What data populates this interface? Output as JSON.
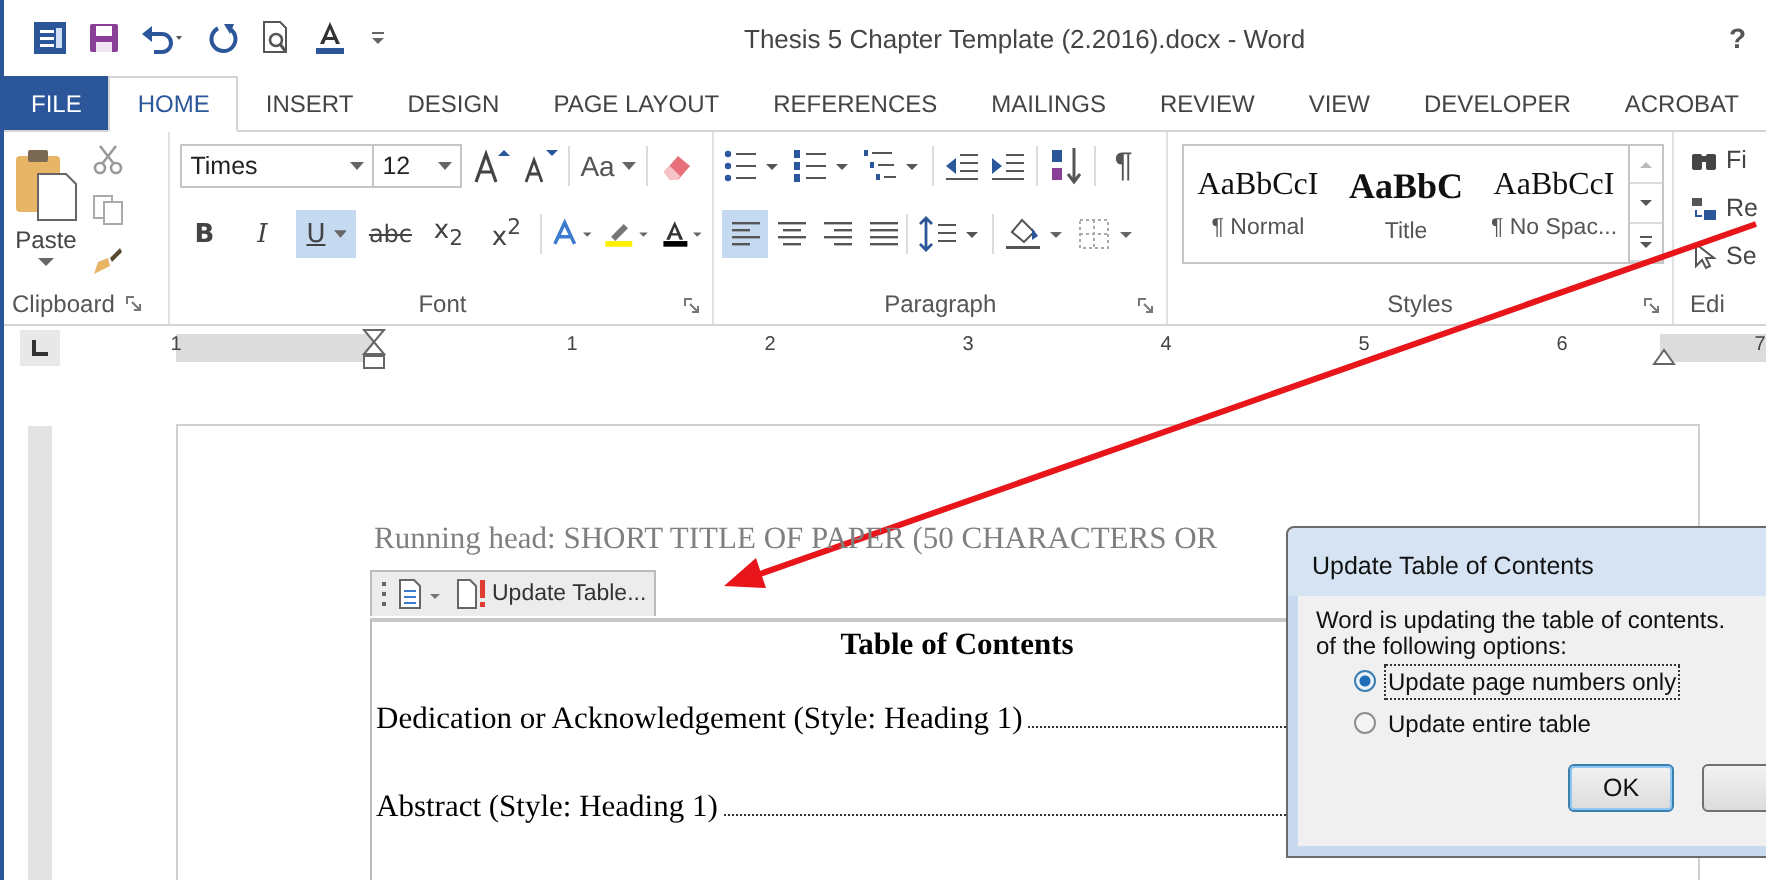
{
  "window": {
    "title": "Thesis 5 Chapter Template (2.2016).docx - Word",
    "help": "?"
  },
  "tabs": [
    {
      "label": "FILE",
      "kind": "file",
      "selected": false
    },
    {
      "label": "HOME",
      "kind": "tab",
      "selected": true
    },
    {
      "label": "INSERT",
      "kind": "tab",
      "selected": false
    },
    {
      "label": "DESIGN",
      "kind": "tab",
      "selected": false
    },
    {
      "label": "PAGE LAYOUT",
      "kind": "tab",
      "selected": false
    },
    {
      "label": "REFERENCES",
      "kind": "tab",
      "selected": false
    },
    {
      "label": "MAILINGS",
      "kind": "tab",
      "selected": false
    },
    {
      "label": "REVIEW",
      "kind": "tab",
      "selected": false
    },
    {
      "label": "VIEW",
      "kind": "tab",
      "selected": false
    },
    {
      "label": "DEVELOPER",
      "kind": "tab",
      "selected": false
    },
    {
      "label": "ACROBAT",
      "kind": "tab",
      "selected": false
    }
  ],
  "clipboard": {
    "paste": "Paste",
    "label": "Clipboard"
  },
  "font": {
    "face": "Times",
    "size": "12",
    "case": "Aa",
    "label": "Font",
    "format": [
      {
        "label": "B",
        "kind": "bold",
        "on": false
      },
      {
        "label": "I",
        "kind": "italic",
        "on": false
      },
      {
        "label": "U",
        "kind": "underline",
        "on": true
      },
      {
        "label": "abc",
        "kind": "strike",
        "on": false
      },
      {
        "label": "x$_{2}$",
        "kind": "plain",
        "on": false
      },
      {
        "label": "x$^{2}$",
        "kind": "plain",
        "on": false
      }
    ]
  },
  "paragraph": {
    "label": "Paragraph",
    "marks": "¶",
    "align": [
      {
        "kind": "left",
        "on": true
      },
      {
        "kind": "center",
        "on": false
      },
      {
        "kind": "right",
        "on": false
      },
      {
        "kind": "justify",
        "on": false
      }
    ]
  },
  "styles": {
    "label": "Styles",
    "items": [
      {
        "sample": "AaBbCcI",
        "name": "¶ Normal",
        "kind": "normal"
      },
      {
        "sample": "AaBbC",
        "name": "Title",
        "kind": "title"
      },
      {
        "sample": "AaBbCcI",
        "name": "¶ No Spac...",
        "kind": "normal"
      }
    ]
  },
  "editing": {
    "label": "Edi",
    "items": [
      "Fi",
      "Re",
      "Se"
    ]
  },
  "ruler": {
    "labels": [
      "1",
      "1",
      "2",
      "3",
      "4",
      "5",
      "6",
      "7"
    ]
  },
  "document": {
    "running_head": "Running head: SHORT TITLE OF PAPER (50 CHARACTERS OR",
    "toc_control": "Update Table...",
    "toc_title": "Table of Contents",
    "entries": [
      "Dedication or Acknowledgement (Style: Heading 1)",
      "Abstract (Style: Heading 1)"
    ]
  },
  "dialog": {
    "title": "Update Table of Contents",
    "message": [
      "Word is updating the table of contents.",
      "of the following options:"
    ],
    "options": [
      {
        "label": "Update page numbers only",
        "selected": true
      },
      {
        "label": "Update entire table",
        "selected": false
      }
    ],
    "ok": "OK"
  }
}
